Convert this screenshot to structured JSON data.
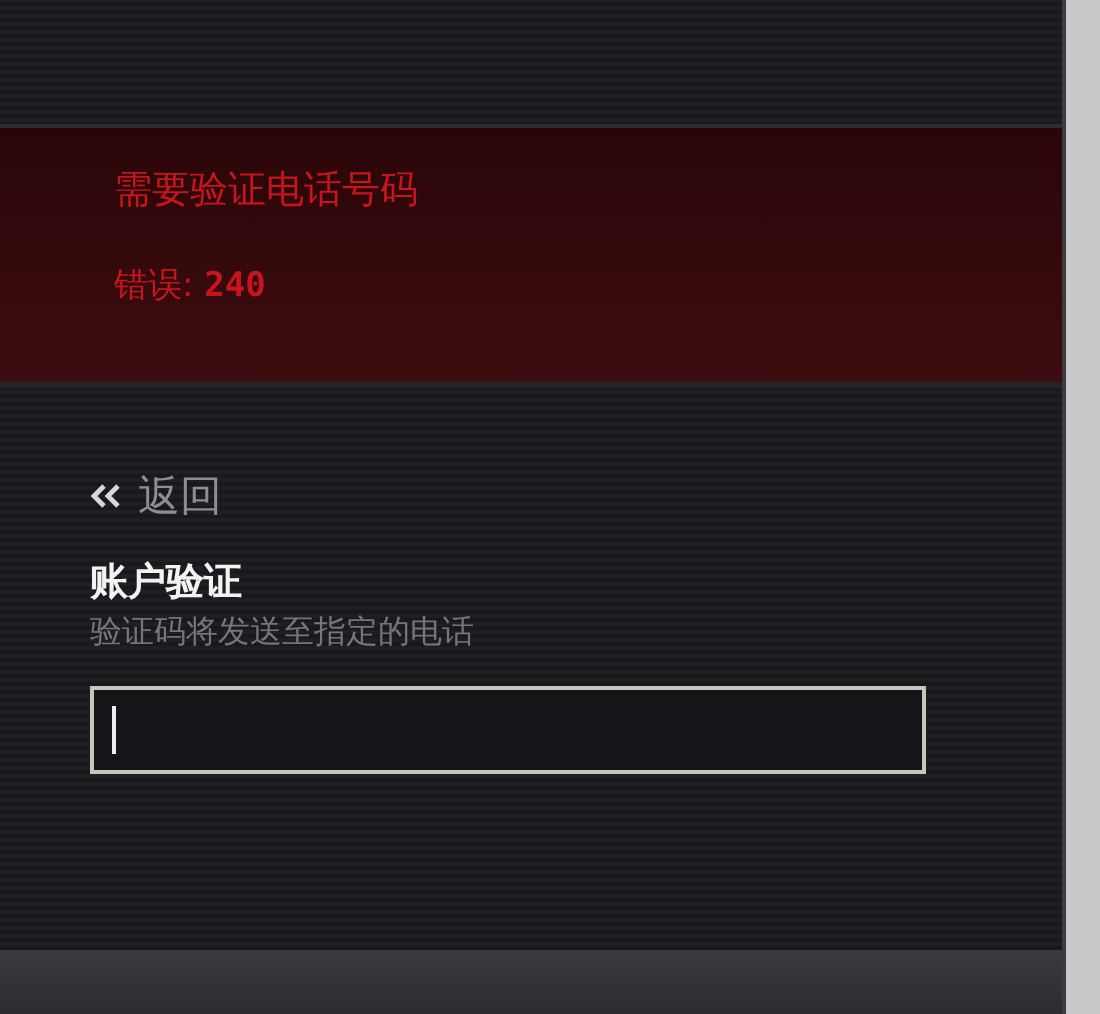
{
  "error_banner": {
    "title": "需要验证电话号码",
    "detail": "错误: **240**"
  },
  "back_link": {
    "label": "返回"
  },
  "section": {
    "title": "账户验证",
    "subtitle": "验证码将发送至指定的电话"
  },
  "code_field": {
    "focused": true
  }
}
